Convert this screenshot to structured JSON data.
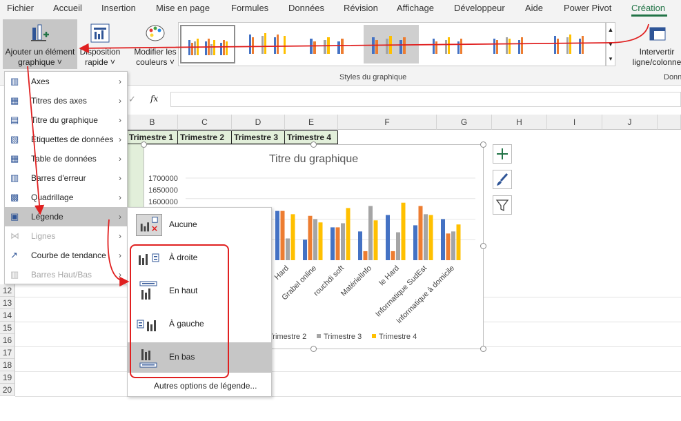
{
  "ribbon_tabs": [
    "Fichier",
    "Accueil",
    "Insertion",
    "Mise en page",
    "Formules",
    "Données",
    "Révision",
    "Affichage",
    "Développeur",
    "Aide",
    "Power Pivot",
    "Création"
  ],
  "ribbon": {
    "add_element_label": "Ajouter un élément",
    "add_element_label2": "graphique ˅",
    "quick_layout_label": "Disposition",
    "quick_layout_label2": "rapide ˅",
    "colors_label": "Modifier les",
    "colors_label2": "couleurs ˅",
    "switch_label": "Intervertir",
    "switch_label2": "ligne/colonne",
    "styles_group": "Styles du graphique",
    "data_group_partial": "Donn",
    "gallery_thumb_title": "Titre du graphique"
  },
  "formula_bar": {
    "fx": "fx",
    "check": "✓"
  },
  "columns": [
    "B",
    "C",
    "D",
    "E",
    "F",
    "G",
    "H",
    "I",
    "J"
  ],
  "rows": [
    "12",
    "13",
    "14",
    "15",
    "16",
    "17",
    "18",
    "19",
    "20"
  ],
  "header_cells": [
    "Trimestre 1",
    "Trimestre 2",
    "Trimestre 3",
    "Trimestre 4"
  ],
  "menu": {
    "items": [
      {
        "label": "Axes",
        "icon": "axes-icon",
        "disabled": false
      },
      {
        "label": "Titres des axes",
        "icon": "axis-titles-icon",
        "disabled": false
      },
      {
        "label": "Titre du graphique",
        "icon": "chart-title-icon",
        "disabled": false
      },
      {
        "label": "Étiquettes de données",
        "icon": "data-labels-icon",
        "disabled": false
      },
      {
        "label": "Table de données",
        "icon": "data-table-icon",
        "disabled": false
      },
      {
        "label": "Barres d'erreur",
        "icon": "error-bars-icon",
        "disabled": false
      },
      {
        "label": "Quadrillage",
        "icon": "gridlines-icon",
        "disabled": false
      },
      {
        "label": "Légende",
        "icon": "legend-icon",
        "disabled": false
      },
      {
        "label": "Lignes",
        "icon": "lines-icon",
        "disabled": true
      },
      {
        "label": "Courbe de tendance",
        "icon": "trendline-icon",
        "disabled": false
      },
      {
        "label": "Barres Haut/Bas",
        "icon": "updown-bars-icon",
        "disabled": true
      }
    ]
  },
  "legend_submenu": {
    "items": [
      {
        "label": "Aucune"
      },
      {
        "label": "À droite"
      },
      {
        "label": "En haut"
      },
      {
        "label": "À gauche"
      },
      {
        "label": "En bas"
      }
    ],
    "more_options": "Autres options de légende..."
  },
  "chart_data": {
    "type": "bar",
    "title": "Titre du graphique",
    "y_ticks": [
      "1700000",
      "1650000",
      "1600000"
    ],
    "categories": [
      "Hard",
      "Grabel online",
      "rouchdi soft",
      "MatérielInfo",
      "le Hard",
      "Informatique SudEst",
      "informatique à domicile"
    ],
    "series": [
      {
        "name": "Trimestre 1",
        "color": "#4472c4",
        "values": [
          1620000,
          1550000,
          1580000,
          1570000,
          1610000,
          1585000,
          1600000
        ]
      },
      {
        "name": "Trimestre 2",
        "color": "#ed7d31",
        "values": [
          1620000,
          1608000,
          1580000,
          1522000,
          1522000,
          1632000,
          1565000
        ]
      },
      {
        "name": "Trimestre 3",
        "color": "#a5a5a5",
        "values": [
          1553000,
          1600000,
          1590000,
          1632000,
          1568000,
          1612000,
          1570000
        ]
      },
      {
        "name": "Trimestre 4",
        "color": "#ffc000",
        "values": [
          1612000,
          1592000,
          1627000,
          1597000,
          1640000,
          1610000,
          1587000
        ]
      }
    ],
    "legend_visible": [
      "Trimestre 2",
      "Trimestre 3",
      "Trimestre 4"
    ],
    "ylim": [
      1500000,
      1700000
    ],
    "legend": "bottom"
  }
}
